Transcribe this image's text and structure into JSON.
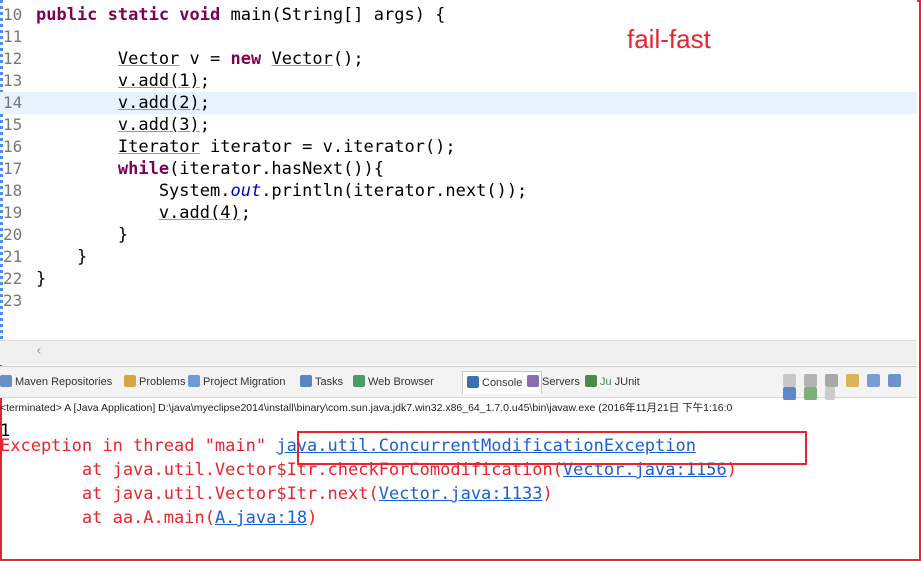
{
  "annotation": "fail-fast",
  "editor": {
    "lines": [
      {
        "n": "10",
        "t": [
          {
            "k": "kw",
            "s": "public static void "
          },
          {
            "k": "p",
            "s": "main(String[] args) {"
          }
        ],
        "ln_sup": "⊖"
      },
      {
        "n": "11",
        "t": []
      },
      {
        "n": "12",
        "t": [
          {
            "k": "p",
            "s": "        "
          },
          {
            "k": "ul",
            "s": "Vector"
          },
          {
            "k": "p",
            "s": " v = "
          },
          {
            "k": "kw",
            "s": "new "
          },
          {
            "k": "ul",
            "s": "Vector"
          },
          {
            "k": "p",
            "s": "();"
          }
        ]
      },
      {
        "n": "13",
        "t": [
          {
            "k": "p",
            "s": "        "
          },
          {
            "k": "ul",
            "s": "v.add(1)"
          },
          {
            "k": "p",
            "s": ";"
          }
        ]
      },
      {
        "n": "14",
        "t": [
          {
            "k": "p",
            "s": "        "
          },
          {
            "k": "ul",
            "s": "v.add(2)"
          },
          {
            "k": "p",
            "s": ";"
          }
        ],
        "hl": true
      },
      {
        "n": "15",
        "t": [
          {
            "k": "p",
            "s": "        "
          },
          {
            "k": "ul",
            "s": "v.add(3)"
          },
          {
            "k": "p",
            "s": ";"
          }
        ]
      },
      {
        "n": "16",
        "t": [
          {
            "k": "p",
            "s": "        "
          },
          {
            "k": "ul",
            "s": "Iterator"
          },
          {
            "k": "p",
            "s": " iterator = v.iterator();"
          }
        ]
      },
      {
        "n": "17",
        "t": [
          {
            "k": "p",
            "s": "        "
          },
          {
            "k": "kw",
            "s": "while"
          },
          {
            "k": "p",
            "s": "(iterator.hasNext()){"
          }
        ]
      },
      {
        "n": "18",
        "t": [
          {
            "k": "p",
            "s": "            System."
          },
          {
            "k": "field",
            "s": "out"
          },
          {
            "k": "p",
            "s": ".println(iterator.next());"
          }
        ]
      },
      {
        "n": "19",
        "t": [
          {
            "k": "p",
            "s": "            "
          },
          {
            "k": "ul",
            "s": "v.add(4)"
          },
          {
            "k": "p",
            "s": ";"
          }
        ]
      },
      {
        "n": "20",
        "t": [
          {
            "k": "p",
            "s": "        }"
          }
        ]
      },
      {
        "n": "21",
        "t": [
          {
            "k": "p",
            "s": "    }"
          }
        ]
      },
      {
        "n": "22",
        "t": [
          {
            "k": "p",
            "s": "}"
          }
        ]
      },
      {
        "n": "23",
        "t": []
      }
    ],
    "scroll_left": "‹"
  },
  "tabs": [
    {
      "label": "Maven Repositories",
      "icon_color": "#6b8fc4"
    },
    {
      "label": "Problems",
      "icon_color": "#d9a441"
    },
    {
      "label": "Project Migration",
      "icon_color": "#6a9bd8"
    },
    {
      "label": "Tasks",
      "icon_color": "#5a86c6"
    },
    {
      "label": "Web Browser",
      "icon_color": "#4a9a6a"
    },
    {
      "label": "Console",
      "icon_color": "#3d6fb5",
      "active": true,
      "close": "✕"
    },
    {
      "label": "Servers",
      "icon_color": "#8a6fb0"
    },
    {
      "label": "JUnit",
      "icon_color": "#4a8a4a",
      "prefix": "Ju"
    }
  ],
  "console": {
    "status": "<terminated> A [Java Application] D:\\java\\myeclipse2014\\install\\binary\\com.sun.java.jdk7.win32.x86_64_1.7.0.u45\\bin\\javaw.exe (2016年11月21日 下午1:16:0",
    "output_first": "1",
    "exception_prefix": "Exception in thread \"main\" ",
    "exception_link": "java.util.ConcurrentModificationException",
    "trace": [
      {
        "prefix": "\tat java.util.Vector$Itr.checkForComodification(",
        "link": "Vector.java:1156",
        "suffix": ")"
      },
      {
        "prefix": "\tat java.util.Vector$Itr.next(",
        "link": "Vector.java:1133",
        "suffix": ")"
      },
      {
        "prefix": "\tat aa.A.main(",
        "link": "A.java:18",
        "suffix": ")"
      }
    ]
  },
  "colors": {
    "accent_red": "#e8242c",
    "link_blue": "#1a5fd6",
    "keyword": "#7f0055"
  }
}
